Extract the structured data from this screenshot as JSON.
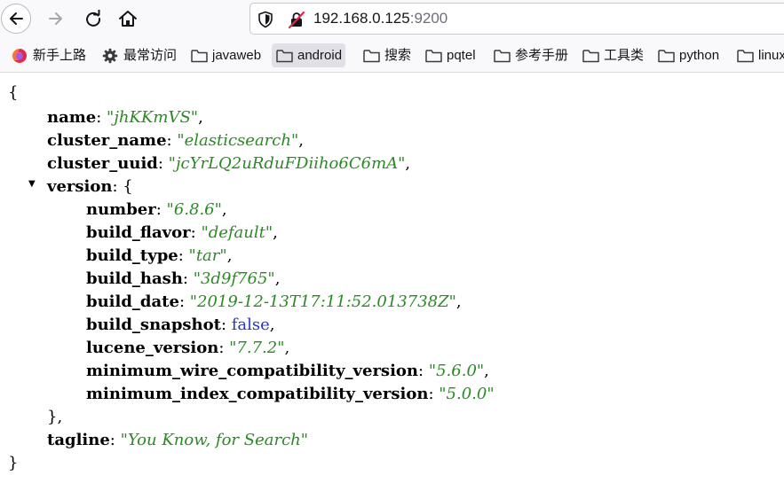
{
  "browser": {
    "url_host": "192.168.0.125",
    "url_port": ":9200",
    "bookmarks": [
      {
        "label": "新手上路",
        "icon": "firefox-icon"
      },
      {
        "label": "最常访问",
        "icon": "gear-icon"
      },
      {
        "label": "javaweb",
        "icon": "folder-icon"
      },
      {
        "label": "android",
        "icon": "folder-icon",
        "active": true
      },
      {
        "label": "搜索",
        "icon": "folder-icon"
      },
      {
        "label": "pqtel",
        "icon": "folder-icon"
      },
      {
        "label": "参考手册",
        "icon": "folder-icon"
      },
      {
        "label": "工具类",
        "icon": "folder-icon"
      },
      {
        "label": "python",
        "icon": "folder-icon"
      },
      {
        "label": "linux",
        "icon": "folder-icon"
      }
    ]
  },
  "json": {
    "open_brace": "{",
    "close_brace": "}",
    "version_open": "{",
    "version_close": "},",
    "toggle_glyph": "▼",
    "fields": [
      {
        "key": "name",
        "value": "\"jhKKmVS\"",
        "type": "string",
        "trail": ","
      },
      {
        "key": "cluster_name",
        "value": "\"elasticsearch\"",
        "type": "string",
        "trail": ","
      },
      {
        "key": "cluster_uuid",
        "value": "\"jcYrLQ2uRduFDiiho6C6mA\"",
        "type": "string",
        "trail": ","
      },
      {
        "key": "version",
        "type": "object"
      },
      {
        "key": "tagline",
        "value": "\"You Know, for Search\"",
        "type": "string",
        "trail": ""
      }
    ],
    "version": [
      {
        "key": "number",
        "value": "\"6.8.6\"",
        "type": "string",
        "trail": ","
      },
      {
        "key": "build_flavor",
        "value": "\"default\"",
        "type": "string",
        "trail": ","
      },
      {
        "key": "build_type",
        "value": "\"tar\"",
        "type": "string",
        "trail": ","
      },
      {
        "key": "build_hash",
        "value": "\"3d9f765\"",
        "type": "string",
        "trail": ","
      },
      {
        "key": "build_date",
        "value": "\"2019-12-13T17:11:52.013738Z\"",
        "type": "string",
        "trail": ","
      },
      {
        "key": "build_snapshot",
        "value": "false",
        "type": "bool",
        "trail": ","
      },
      {
        "key": "lucene_version",
        "value": "\"7.7.2\"",
        "type": "string",
        "trail": ","
      },
      {
        "key": "minimum_wire_compatibility_version",
        "value": "\"5.6.0\"",
        "type": "string",
        "trail": ","
      },
      {
        "key": "minimum_index_compatibility_version",
        "value": "\"5.0.0\"",
        "type": "string",
        "trail": ""
      }
    ]
  }
}
